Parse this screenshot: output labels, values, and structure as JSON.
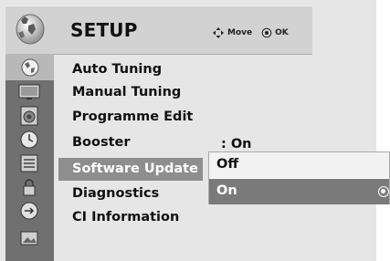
{
  "header": {
    "title": "SETUP",
    "hint_move": "Move",
    "hint_ok": "OK"
  },
  "sidebar": {
    "icons": [
      "setup-globe-icon",
      "picture-tv-icon",
      "audio-speaker-icon",
      "time-clock-icon",
      "option-list-icon",
      "lock-icon",
      "input-icon",
      "usb-photo-icon"
    ],
    "active_index": 0
  },
  "menu": {
    "items": [
      {
        "label": "Auto Tuning"
      },
      {
        "label": "Manual Tuning"
      },
      {
        "label": "Programme Edit"
      },
      {
        "label": "Booster",
        "value": ": On"
      },
      {
        "label": "Software Update",
        "selected": true
      },
      {
        "label": "Diagnostics"
      },
      {
        "label": "CI Information"
      }
    ]
  },
  "popup": {
    "options": [
      {
        "label": "Off"
      },
      {
        "label": "On",
        "selected": true
      }
    ]
  },
  "colors": {
    "panel": "#e6e6e6",
    "header": "#d2d2d2",
    "sidebar": "#707070",
    "selection": "#8e8e8e",
    "option_selected": "#7a7a7a"
  }
}
